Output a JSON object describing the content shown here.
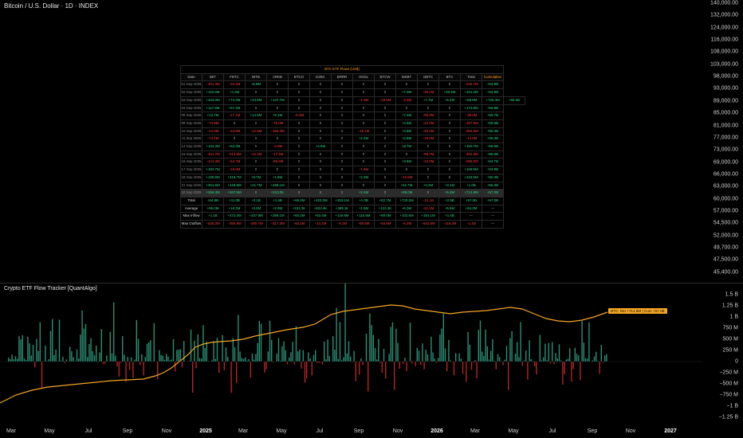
{
  "header": {
    "title": "Bitcoin / U.S. Dollar · 1D · INDEX"
  },
  "price_axis": [
    "140,000.00",
    "132,000.00",
    "124,000.00",
    "116,000.00",
    "108,000.00",
    "103,000.00",
    "98,000.00",
    "93,000.00",
    "89,000.00",
    "85,000.00",
    "81,000.00",
    "77,000.00",
    "73,000.00",
    "69,000.00",
    "66,000.00",
    "63,000.00",
    "60,000.00",
    "57,000.00",
    "54,500.00",
    "52,000.00",
    "49,700.00",
    "47,500.00",
    "45,400.00"
  ],
  "indicator": {
    "title": "Crypto ETF Flow Tracker [QuantAlgo]",
    "badge": "BTC: Net +714.8M | Cum +57.0B",
    "bar_green": "#2a8f74",
    "bar_red": "#b32424",
    "line_color": "#f5a623"
  },
  "flow_axis": [
    "1.5 B",
    "1.25 B",
    "1 B",
    "750 M",
    "500 M",
    "250 M",
    "0",
    "−250 M",
    "−500 M",
    "−750 M",
    "−1 B",
    "−1.25 B"
  ],
  "time_axis": [
    {
      "label": "Mar",
      "major": false
    },
    {
      "label": "May",
      "major": false
    },
    {
      "label": "Jul",
      "major": false
    },
    {
      "label": "Sep",
      "major": false
    },
    {
      "label": "Nov",
      "major": false
    },
    {
      "label": "2025",
      "major": true
    },
    {
      "label": "Mar",
      "major": false
    },
    {
      "label": "May",
      "major": false
    },
    {
      "label": "Jul",
      "major": false
    },
    {
      "label": "Sep",
      "major": false
    },
    {
      "label": "Nov",
      "major": false
    },
    {
      "label": "2026",
      "major": true
    },
    {
      "label": "Mar",
      "major": false
    },
    {
      "label": "May",
      "major": false
    },
    {
      "label": "Jul",
      "major": false
    },
    {
      "label": "Sep",
      "major": false
    },
    {
      "label": "Nov",
      "major": false
    },
    {
      "label": "2027",
      "major": true
    }
  ],
  "table": {
    "title": "BTC ETF Flows (US$)",
    "columns": [
      "Date",
      "IBIT",
      "FBTC",
      "BITB",
      "ARKB",
      "BTCO",
      "EZBC",
      "BRRR",
      "HODL",
      "BTCW",
      "MSBT",
      "GBTC",
      "BTC",
      "Total",
      "Cumulative"
    ],
    "rows": [
      [
        "01 Sep 2025",
        "−201.3M",
        "−33.2M",
        "+6.8M",
        "0",
        "0",
        "0",
        "0",
        "0",
        "0",
        "0",
        "0",
        "0",
        "−226.7M",
        "+54.9B"
      ],
      [
        "02 Sep 2025",
        "+115.6M",
        "+4.2M",
        "0",
        "0",
        "0",
        "0",
        "0",
        "0",
        "0",
        "+7.3M",
        "−35.1M",
        "+30.4M",
        "+101.2M",
        "+54.9B"
      ],
      [
        "03 Sep 2025",
        "+434.0M",
        "+74.4M",
        "+24.8M",
        "+137.7M",
        "0",
        "0",
        "0",
        "−2.3M",
        "−18.6M",
        "−3.0M",
        "+7.7M",
        "+6.2M",
        "+68.8M",
        "+725.4M",
        "+55.6B"
      ],
      [
        "04 Sep 2025",
        "+117.6M",
        "+57.2M",
        "0",
        "0",
        "0",
        "0",
        "0",
        "0",
        "0",
        "0",
        "0",
        "0",
        "+174.8M",
        "+55.8B"
      ],
      [
        "05 Sep 2025",
        "+12.7M",
        "−17.1M",
        "+14.5M",
        "+6.1M",
        "−6.3M",
        "0",
        "0",
        "0",
        "0",
        "+7.4M",
        "−55.3M",
        "0",
        "−38.6M",
        "+55.7B"
      ],
      [
        "08 Sep 2025",
        "−74.8M",
        "0",
        "0",
        "−75.0M",
        "0",
        "0",
        "0",
        "0",
        "0",
        "+4.5M",
        "−22.2M",
        "0",
        "−167.5M",
        "+55.6B"
      ],
      [
        "10 Sep 2025",
        "−24.0M",
        "−13.8M",
        "−12.9M",
        "−156.3M",
        "0",
        "0",
        "0",
        "−15.1M",
        "0",
        "+4.8M",
        "−30.4M",
        "0",
        "−252.6M",
        "+55.3B"
      ],
      [
        "11 Sep 2025",
        "−74.2M",
        "0",
        "0",
        "0",
        "0",
        "0",
        "0",
        "+2.2M",
        "0",
        "+2.8M",
        "−19.4M",
        "0",
        "−14.6M",
        "+55.3B"
      ],
      [
        "14 Sep 2025",
        "+134.3M",
        "+53.3M",
        "0",
        "−4.0M",
        "0",
        "+4.6M",
        "0",
        "0",
        "0",
        "+8.7M",
        "0",
        "0",
        "+160.7M",
        "+55.5B"
      ],
      [
        "15 Sep 2025",
        "−101.7M",
        "−213.5M",
        "−12.4M",
        "−17.4M",
        "0",
        "0",
        "0",
        "0",
        "0",
        "0",
        "−56.7M",
        "0",
        "−402.3M",
        "+55.0B"
      ],
      [
        "16 Sep 2025",
        "−144.3M",
        "−54.7M",
        "0",
        "−86.6M",
        "0",
        "0",
        "0",
        "0",
        "0",
        "+3.5M",
        "−10.0M",
        "0",
        "−285.0M",
        "+54.7B"
      ],
      [
        "17 Sep 2025",
        "+182.7M",
        "−19.0M",
        "0",
        "0",
        "0",
        "0",
        "0",
        "−1.6M",
        "0",
        "0",
        "0",
        "0",
        "+159.5M",
        "+54.9B"
      ],
      [
        "18 Sep 2025",
        "+109.8M",
        "+316.7M",
        "+8.7M",
        "+1.8M",
        "0",
        "0",
        "0",
        "+2.3M",
        "0",
        "−10.8M",
        "0",
        "0",
        "+433.0M",
        "+55.3B"
      ],
      [
        "21 Sep 2025",
        "+361.6M",
        "+228.8M",
        "+21.7M",
        "+289.1M",
        "0",
        "0",
        "0",
        "0",
        "0",
        "+61.7M",
        "+3.2M",
        "+3.1M",
        "+1.0B",
        "+56.3B"
      ],
      [
        "22 Sep 2025",
        "+356.3M",
        "+267.6M",
        "0",
        "+513.0K",
        "0",
        "0",
        "0",
        "+2.4M",
        "0",
        "+89.0M",
        "0",
        "+5.0M",
        "+714.8M",
        "+57.0B"
      ]
    ],
    "summary": [
      {
        "label": "Total",
        "values": [
          "+64.9B",
          "+11.0B",
          "+2.1B",
          "+1.4B",
          "+66.2M",
          "+420.0M",
          "+263.1M",
          "+1.0B",
          "+62.7M",
          "+733.2M",
          "−21.1B",
          "+2.9B",
          "+57.0B",
          "+57.0B"
        ]
      },
      {
        "label": "Average",
        "values": [
          "+95.0M",
          "+16.3M",
          "+3.2M",
          "+2.0M",
          "+101.2K",
          "+623.4K",
          "+389.1K",
          "+1.5M",
          "+122.3K",
          "+6.3M",
          "−31.1M",
          "+5.5M",
          "+84.3M",
          "—"
        ]
      },
      {
        "label": "Max Inflow",
        "values": [
          "+1.1B",
          "+472.4M",
          "+237.9M",
          "+289.1M",
          "+60.2M",
          "+63.4M",
          "+116.8M",
          "+116.5M",
          "+89.0M",
          "+102.5M",
          "+191.1M",
          "+1.4B",
          "—",
          "—"
        ]
      },
      {
        "label": "Max Outflow",
        "values": [
          "−525.3M",
          "−356.9M",
          "−280.7M",
          "−317.3M",
          "−60.2M",
          "−14.1M",
          "−6.2M",
          "−90.6M",
          "−54.6M",
          "−6.2M",
          "−642.5M",
          "−118.2M",
          "−1.1B",
          "—"
        ]
      }
    ]
  }
}
